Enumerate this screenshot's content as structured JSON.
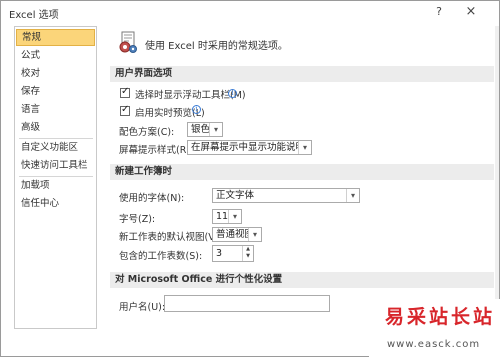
{
  "window": {
    "title": "Excel 选项",
    "help_glyph": "?",
    "close_glyph": "×"
  },
  "sidebar": {
    "items": [
      {
        "label": "常规",
        "active": true
      },
      {
        "label": "公式"
      },
      {
        "label": "校对"
      },
      {
        "label": "保存"
      },
      {
        "label": "语言"
      },
      {
        "label": "高级"
      },
      {
        "label": "自定义功能区"
      },
      {
        "label": "快速访问工具栏"
      },
      {
        "label": "加载项"
      },
      {
        "label": "信任中心"
      }
    ]
  },
  "header": {
    "icon": "options-gear-icon",
    "text": "使用 Excel 时采用的常规选项。"
  },
  "sections": {
    "ui": {
      "title": "用户界面选项",
      "mini_toolbar_label": "选择时显示浮动工具栏(M)",
      "mini_toolbar_checked": true,
      "live_preview_label": "启用实时预览(L)",
      "live_preview_checked": true,
      "check_glyph": "✓",
      "info_glyph": "i",
      "color_scheme_label": "配色方案(C):",
      "color_scheme_value": "银色",
      "screentip_label": "屏幕提示样式(R):",
      "screentip_value": "在屏幕提示中显示功能说明"
    },
    "new_workbook": {
      "title": "新建工作簿时",
      "font_label": "使用的字体(N):",
      "font_value": "正文字体",
      "size_label": "字号(Z):",
      "size_value": "11",
      "view_label": "新工作表的默认视图(V):",
      "view_value": "普通视图",
      "sheets_label": "包含的工作表数(S):",
      "sheets_value": "3"
    },
    "personalize": {
      "title": "对 Microsoft Office 进行个性化设置",
      "username_label": "用户名(U):",
      "username_value": ""
    }
  },
  "controls": {
    "dropdown_glyph": "▾",
    "spin_up_glyph": "▲",
    "spin_down_glyph": "▼"
  },
  "watermark": {
    "text": "易采站长站",
    "url": "www.easck.com"
  },
  "colors": {
    "active_nav": "#fbd57a",
    "section_bar": "#ececec",
    "watermark_red": "#d8262b"
  }
}
